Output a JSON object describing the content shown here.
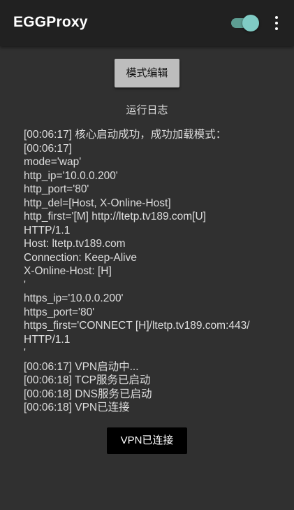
{
  "appbar": {
    "title": "EGGProxy",
    "vpn_switch_on": true,
    "switch_color": "#80cbc4",
    "switch_track_color": "#5e9e93",
    "overflow_icon": "more-vert-icon"
  },
  "main": {
    "mode_edit_label": "模式编辑",
    "log_title": "运行日志",
    "log_lines": [
      "[00:06:17] 核心启动成功，成功加载模式：",
      "[00:06:17]",
      "mode='wap'",
      "http_ip='10.0.0.200'",
      "http_port='80'",
      "http_del=[Host, X-Online-Host]",
      "http_first='[M] http://ltetp.tv189.com[U]",
      "HTTP/1.1",
      "Host: ltetp.tv189.com",
      "Connection: Keep-Alive",
      "X-Online-Host: [H]",
      "'",
      "https_ip='10.0.0.200'",
      "https_port='80'",
      "https_first='CONNECT [H]/ltetp.tv189.com:443/",
      "HTTP/1.1",
      "'",
      "[00:06:17] VPN启动中...",
      "[00:06:18] TCP服务已启动",
      "[00:06:18] DNS服务已启动",
      "[00:06:18] VPN已连接"
    ],
    "vpn_button_label": "VPN已连接"
  }
}
